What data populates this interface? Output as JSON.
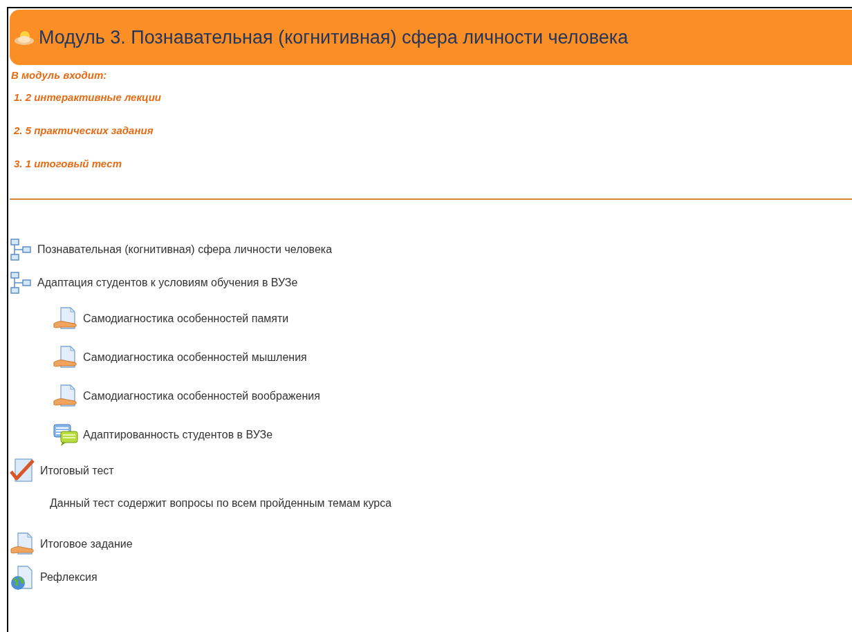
{
  "section": {
    "title": "Модуль 3. Познавательная (когнитивная) сфера личности человека"
  },
  "summary": {
    "heading": "В модуль входит:",
    "items": [
      "1. 2 интерактивные лекции",
      "2. 5 практических задания",
      "3. 1 итоговый тест"
    ]
  },
  "activities": [
    {
      "kind": "lesson",
      "label": "Познавательная (когнитивная) сфера личности человека"
    },
    {
      "kind": "lesson",
      "label": "Адаптация студентов к условиям обучения в ВУЗе",
      "children": [
        {
          "kind": "assignment",
          "label": "Самодиагностика особенностей памяти"
        },
        {
          "kind": "assignment",
          "label": "Самодиагностика особенностей мышления"
        },
        {
          "kind": "assignment",
          "label": "Самодиагностика особенностей воображения"
        },
        {
          "kind": "forum",
          "label": "Адаптированность студентов в ВУЗе"
        }
      ]
    },
    {
      "kind": "quiz",
      "label": "Итоговый тест",
      "description": "Данный тест содержит вопросы по всем пройденным темам курса"
    },
    {
      "kind": "assignment",
      "label": "Итоговое задание"
    },
    {
      "kind": "url",
      "label": "Рефлексия"
    }
  ]
}
